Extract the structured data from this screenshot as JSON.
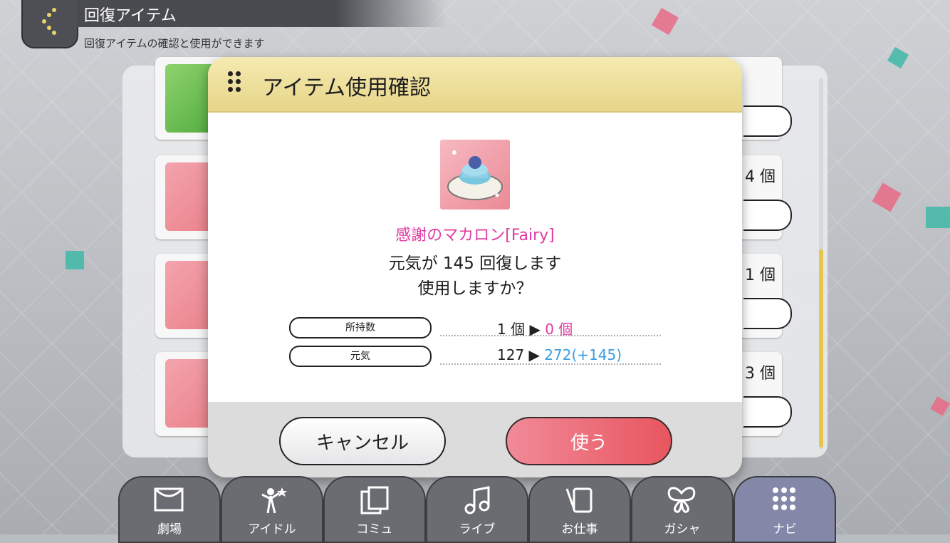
{
  "header": {
    "title": "回復アイテム",
    "subtitle": "回復アイテムの確認と使用ができます",
    "back_icon": "chevron-left-icon"
  },
  "list": {
    "items": [
      {
        "count": "",
        "thumb": "green"
      },
      {
        "count": "4 個",
        "thumb": "pink"
      },
      {
        "count": "1 個",
        "thumb": "pink"
      },
      {
        "count": "3 個",
        "thumb": "pink"
      }
    ]
  },
  "modal": {
    "title": "アイテム使用確認",
    "item_name": "感謝のマカロン[Fairy]",
    "message_line1": "元気が 145 回復します",
    "message_line2": "使用しますか？",
    "stats": [
      {
        "label": "所持数",
        "before": "1 個 ▶ ",
        "after": "0 個",
        "delta": ""
      },
      {
        "label": "元気",
        "before": "127 ▶ ",
        "after": "272",
        "delta": "(+145)"
      }
    ],
    "cancel_label": "キャンセル",
    "use_label": "使う"
  },
  "nav": {
    "tabs": [
      {
        "label": "劇場",
        "icon": "theater-icon"
      },
      {
        "label": "アイドル",
        "icon": "idol-icon"
      },
      {
        "label": "コミュ",
        "icon": "commu-icon"
      },
      {
        "label": "ライブ",
        "icon": "music-note-icon"
      },
      {
        "label": "お仕事",
        "icon": "work-icon"
      },
      {
        "label": "ガシャ",
        "icon": "butterfly-icon"
      },
      {
        "label": "ナビ",
        "icon": "grid-dots-icon"
      }
    ],
    "active": "ナビ"
  },
  "colors": {
    "accent_pink": "#e03aa0",
    "accent_blue": "#3a9ee0",
    "modal_header": "#f5eab0",
    "use_button": "#e8565f"
  }
}
